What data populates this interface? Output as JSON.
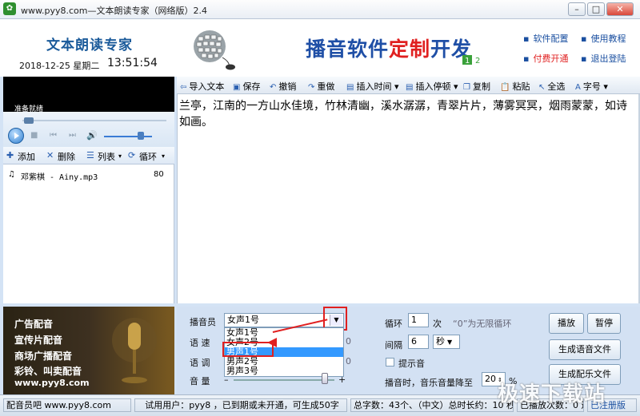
{
  "window": {
    "title": "www.pyy8.com—文本朗读专家（网络版）2.4",
    "min": "–",
    "max": "□",
    "close": "✕"
  },
  "header": {
    "brand": "文本朗读专家",
    "date": "2018-12-25 星期二",
    "time": "13:51:54",
    "ad_part1": "播音软件",
    "ad_part2": "定制",
    "ad_part3": "开发",
    "links": [
      "软件配置",
      "使用教程",
      "付费开通",
      "退出登陆"
    ]
  },
  "player": {
    "status": "准备就绪"
  },
  "listbar": {
    "add": "添加",
    "delete": "删除",
    "list": "列表",
    "loop": "循环"
  },
  "playlist": [
    {
      "name": "邓紫棋 - Ainy.mp3",
      "volume": "80"
    }
  ],
  "toolbar": {
    "items": [
      "导入文本",
      "保存",
      "撤销",
      "重做",
      "插入时间",
      "插入停顿",
      "复制",
      "粘贴",
      "全选",
      "字号"
    ]
  },
  "editor": {
    "text": "兰亭，江南的一方山水佳境，竹林清幽，溪水潺潺，青翠片片，薄雾冥冥，烟雨蒙蒙，如诗如画。"
  },
  "ads": [
    "广告配音",
    "宣传片配音",
    "商场广播配音",
    "彩铃、叫卖配音",
    "www.pyy8.com"
  ],
  "settings": {
    "announcer_label": "播音员",
    "announcer_value": "女声1号",
    "announcer_options": [
      "女声1号",
      "女声2号",
      "男声1号",
      "男声2号",
      "男声3号"
    ],
    "speed_label": "语 速",
    "pitch_label": "语 调",
    "volume_label": "音 量",
    "minus": "–",
    "plus": "+",
    "zero1": "0",
    "zero2": "0",
    "loop_label": "循环",
    "loop_value": "1",
    "loop_unit": "次",
    "loop_hint": "“0”为无限循环",
    "interval_label": "间隔",
    "interval_value": "6",
    "interval_unit": "秒",
    "beep_label": "提示音",
    "music_label": "播音时，音乐音量降至",
    "music_value": "20",
    "music_unit": "%",
    "play_btn": "播放",
    "pause_btn": "暂停",
    "gen_voice": "生成语音文件",
    "gen_music": "生成配乐文件"
  },
  "statusbar": {
    "site": "配音员吧 www.pyy8.com",
    "user": "试用用户：pyy8 ，已到期或未开通，可生成50字",
    "stats": "总字数：43个、（中文）总时长约：10 秒",
    "played": "已播放次数：0 遍",
    "reg": "已注册版"
  },
  "watermark": "极速下载站",
  "colors": {
    "accent_blue": "#1f4fa6",
    "accent_red": "#e02020",
    "selection": "#3399ff"
  }
}
